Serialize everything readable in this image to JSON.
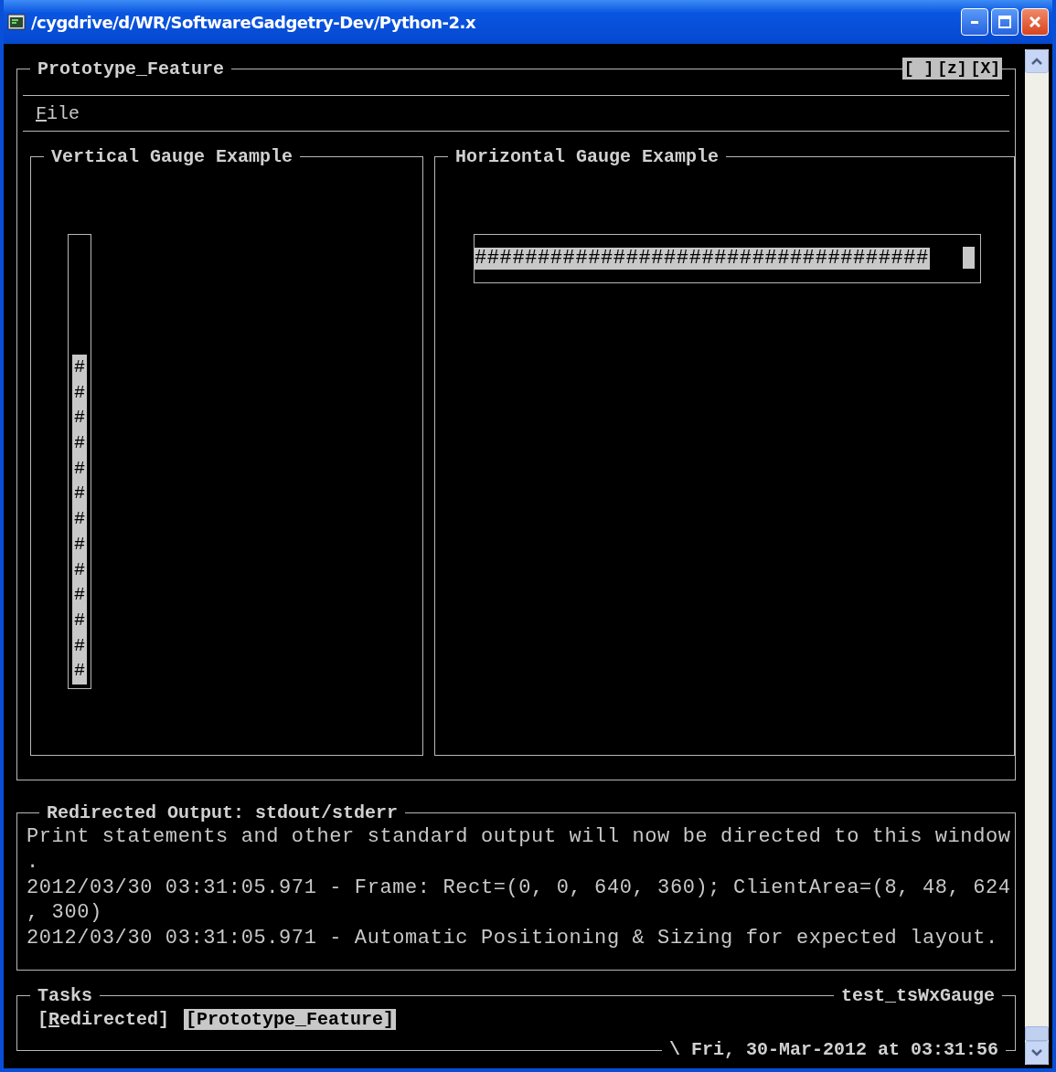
{
  "window": {
    "title": "/cygdrive/d/WR/SoftwareGadgetry-Dev/Python-2.x"
  },
  "frame": {
    "title": "Prototype_Feature",
    "controls": [
      "[ ]",
      "[z]",
      "[X]"
    ]
  },
  "menu": [
    {
      "label": "File"
    }
  ],
  "vertical_gauge": {
    "title": "Vertical Gauge Example",
    "fill": "#############",
    "level": 0.74
  },
  "horizontal_gauge": {
    "title": "Horizontal Gauge Example",
    "fill": "####################################",
    "level": 0.9
  },
  "output": {
    "title": "Redirected Output: stdout/stderr",
    "lines": [
      "Print statements and other standard output will now be directed to this window",
      ".",
      "2012/03/30 03:31:05.971 - Frame: Rect=(0, 0, 640, 360); ClientArea=(8, 48, 624",
      ", 300)",
      "2012/03/30 03:31:05.971 - Automatic Positioning & Sizing for expected layout."
    ]
  },
  "tasks": {
    "title": "Tasks",
    "app": "test_tsWxGauge",
    "items": [
      {
        "label": "[Redirected]",
        "selected": false
      },
      {
        "label": "[Prototype_Feature]",
        "selected": true
      }
    ],
    "status": "\\ Fri, 30-Mar-2012 at 03:31:56"
  }
}
